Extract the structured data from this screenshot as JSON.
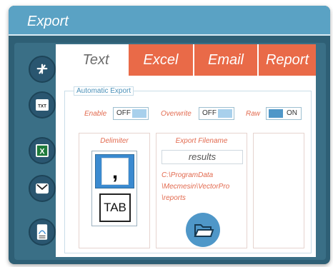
{
  "window": {
    "title": "Export"
  },
  "sidebar": {
    "tools": [
      {
        "name": "tools-icon"
      },
      {
        "name": "txt-file-icon",
        "label": "TXT"
      },
      {
        "name": "excel-icon",
        "label": "X"
      },
      {
        "name": "email-icon"
      },
      {
        "name": "report-icon"
      }
    ]
  },
  "tabs": [
    {
      "label": "Text",
      "active": true
    },
    {
      "label": "Excel",
      "active": false
    },
    {
      "label": "Email",
      "active": false
    },
    {
      "label": "Report",
      "active": false
    }
  ],
  "automatic_export": {
    "label": "Automatic Export",
    "enable": {
      "label": "Enable",
      "state": "OFF"
    },
    "overwrite": {
      "label": "Overwrite",
      "state": "OFF"
    },
    "raw": {
      "label": "Raw",
      "state": "ON"
    }
  },
  "delimiter": {
    "title": "Delimiter",
    "comma": ",",
    "tab": "TAB"
  },
  "export_filename": {
    "title": "Export Filename",
    "value": "results",
    "path_lines": [
      "C:\\ProgramData",
      "\\Mecmesin\\VectorPro",
      "\\reports"
    ]
  },
  "colors": {
    "accent": "#e96a48",
    "title_bar": "#5aa2c4",
    "frame": "#2e5f75",
    "toggle_on": "#4f97c8"
  }
}
